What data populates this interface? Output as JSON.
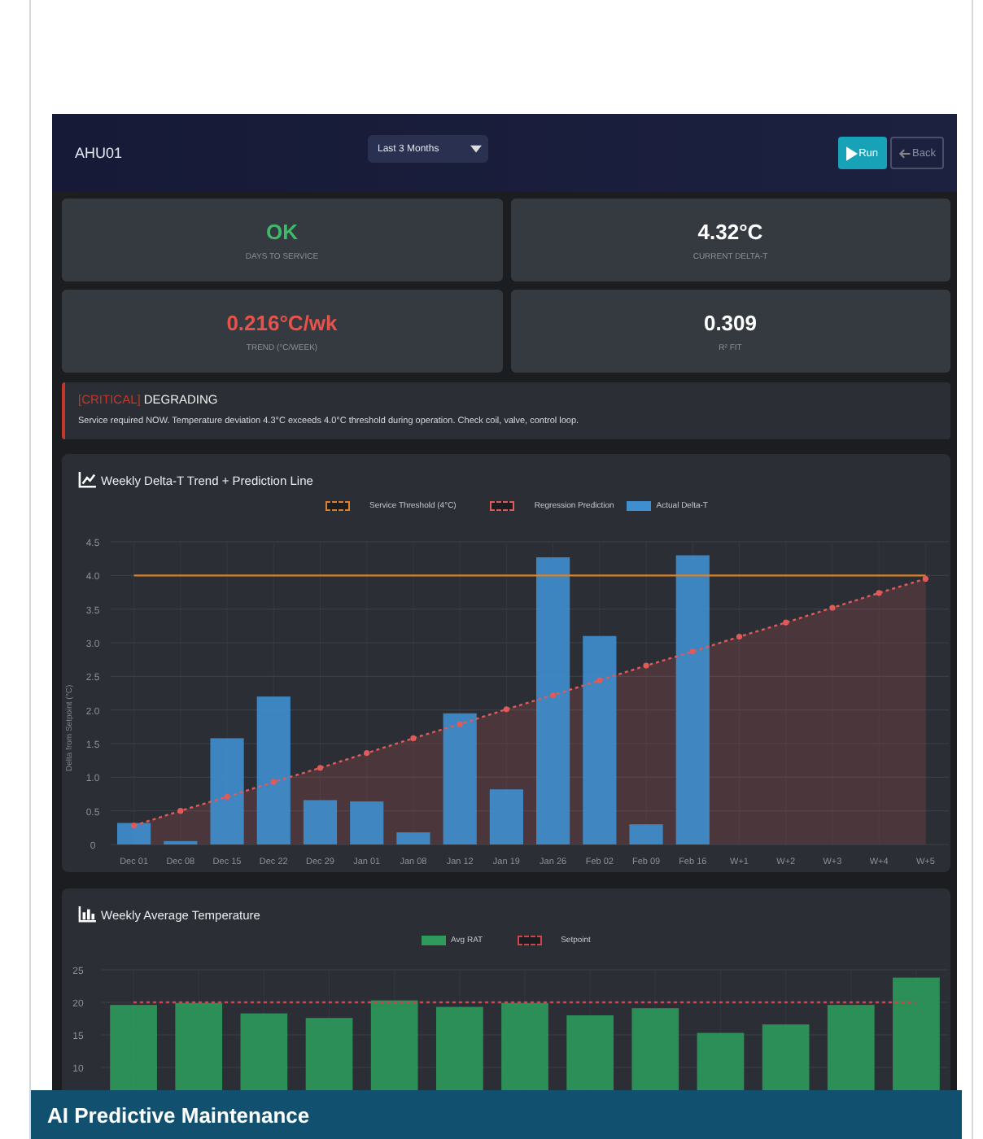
{
  "header": {
    "title": "AHU01",
    "range_select": "Last 3 Months",
    "buttons": [
      {
        "label": "Run",
        "kind": "primary"
      },
      {
        "label": "Back",
        "kind": "outline"
      }
    ]
  },
  "stats": [
    {
      "value": "OK",
      "label": "DAYS TO SERVICE",
      "color": "#3fb96a"
    },
    {
      "value": "4.32°C",
      "label": "CURRENT DELTA-T",
      "color": "#ffffff"
    },
    {
      "value": "0.216°C/wk",
      "label": "TREND (°C/WEEK)",
      "color": "#e5534b"
    },
    {
      "value": "0.309",
      "label": "R² FIT",
      "color": "#ffffff"
    }
  ],
  "alert": {
    "tag": "[CRITICAL]",
    "status": "DEGRADING",
    "message": "Service required NOW. Temperature deviation 4.3°C exceeds 4.0°C threshold during operation. Check coil, valve, control loop."
  },
  "charts": [
    {
      "title": "Weekly Delta-T Trend + Prediction Line",
      "chart_data": {
        "type": "bar",
        "grid": true,
        "ylabel": "Delta from Setpoint (°C)",
        "categories": [
          "Dec 01",
          "Dec 08",
          "Dec 15",
          "Dec 22",
          "Dec 29",
          "Jan 01",
          "Jan 08",
          "Jan 12",
          "Jan 19",
          "Jan 26",
          "Feb 02",
          "Feb 09",
          "Feb 16",
          "W+1",
          "W+2",
          "W+3",
          "W+4",
          "W+5"
        ],
        "ylim": [
          0,
          4.5
        ],
        "yticks": [
          {
            "value": 0,
            "label": "0"
          },
          {
            "value": 0.5,
            "label": "0.5"
          },
          {
            "value": 1,
            "label": "1.0"
          },
          {
            "value": 1.5,
            "label": "1.5"
          },
          {
            "value": 2,
            "label": "2.0"
          },
          {
            "value": 2.5,
            "label": "2.5"
          },
          {
            "value": 3,
            "label": "3.0"
          },
          {
            "value": 3.5,
            "label": "3.5"
          },
          {
            "value": 4,
            "label": "4.0"
          },
          {
            "value": 4.5,
            "label": "4.5"
          }
        ],
        "series": [
          {
            "name": "Service Threshold (4°C)",
            "type": "line",
            "line_style": "solid",
            "color": "#d9822b",
            "values": [
              4,
              4,
              4,
              4,
              4,
              4,
              4,
              4,
              4,
              4,
              4,
              4,
              4,
              4,
              4,
              4,
              4,
              4
            ]
          },
          {
            "name": "Regression Prediction",
            "type": "area",
            "line_style": "dashed",
            "color": "#e05a5a",
            "values": [
              0.28,
              0.5,
              0.71,
              0.93,
              1.14,
              1.36,
              1.58,
              1.79,
              2.01,
              2.22,
              2.44,
              2.66,
              2.87,
              3.09,
              3.3,
              3.52,
              3.74,
              3.95
            ]
          },
          {
            "name": "Actual Delta-T",
            "type": "bar",
            "color": "#3f8fd0",
            "values": [
              0.32,
              0.05,
              1.58,
              2.2,
              0.66,
              0.64,
              0.18,
              1.95,
              0.82,
              4.27,
              3.1,
              0.3,
              4.3,
              null,
              null,
              null,
              null,
              null
            ]
          }
        ]
      }
    },
    {
      "title": "Weekly Average Temperature",
      "chart_data": {
        "type": "bar",
        "grid": true,
        "ylim": [
          5,
          25
        ],
        "yticks": [
          {
            "value": 10,
            "label": "10"
          },
          {
            "value": 15,
            "label": "15"
          },
          {
            "value": 20,
            "label": "20"
          },
          {
            "value": 25,
            "label": "25"
          }
        ],
        "series": [
          {
            "name": "Avg RAT",
            "type": "bar",
            "color": "#2e9a5c",
            "values": [
              19.6,
              19.9,
              18.3,
              17.6,
              20.3,
              19.3,
              19.9,
              18.0,
              19.1,
              15.3,
              16.6,
              19.6,
              23.8
            ]
          },
          {
            "name": "Setpoint",
            "type": "line",
            "line_style": "dashed",
            "color": "#d0454c",
            "values": [
              20,
              20,
              20,
              20,
              20,
              20,
              20,
              20,
              20,
              20,
              20,
              20,
              20
            ]
          }
        ]
      }
    }
  ],
  "caption": "AI Predictive Maintenance"
}
